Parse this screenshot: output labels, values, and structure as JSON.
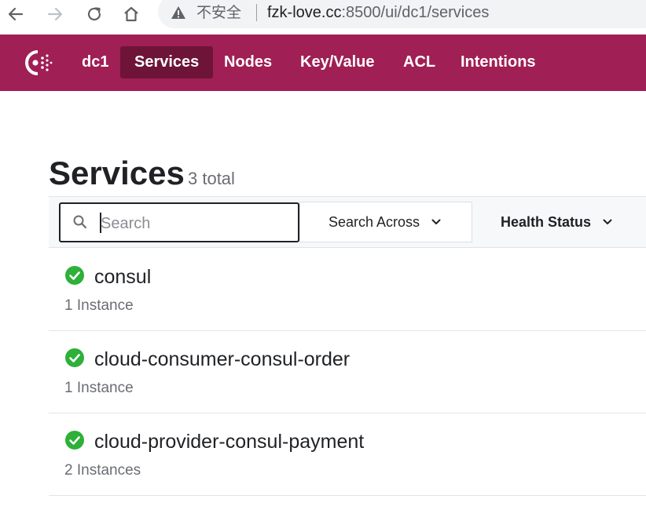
{
  "browser": {
    "insecure_label": "不安全",
    "url_host": "fzk-love.cc",
    "url_rest": ":8500/ui/dc1/services"
  },
  "topnav": {
    "datacenter": "dc1",
    "items": [
      {
        "label": "Services",
        "active": true
      },
      {
        "label": "Nodes",
        "active": false
      },
      {
        "label": "Key/Value",
        "active": false
      },
      {
        "label": "ACL",
        "active": false
      },
      {
        "label": "Intentions",
        "active": false
      }
    ],
    "accent": "#a01f55"
  },
  "header": {
    "title": "Services",
    "total": "3 total"
  },
  "filters": {
    "search_placeholder": "Search",
    "search_across_label": "Search Across",
    "health_status_label": "Health Status"
  },
  "services": [
    {
      "name": "consul",
      "instances": "1 Instance",
      "status": "passing"
    },
    {
      "name": "cloud-consumer-consul-order",
      "instances": "1 Instance",
      "status": "passing"
    },
    {
      "name": "cloud-provider-consul-payment",
      "instances": "2 Instances",
      "status": "passing"
    }
  ],
  "colors": {
    "passing": "#2eb039"
  }
}
